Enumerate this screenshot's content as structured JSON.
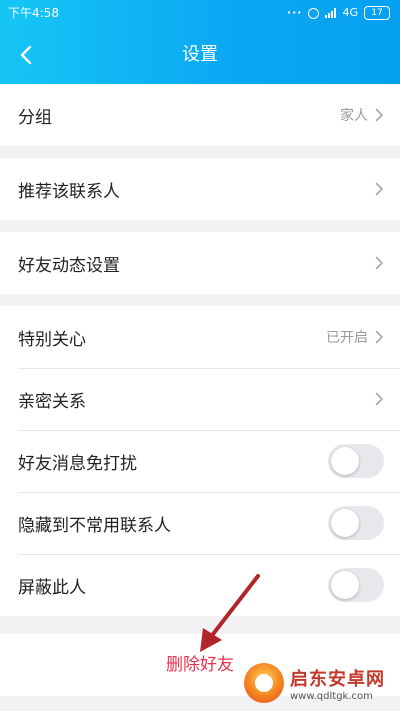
{
  "status_bar": {
    "time": "下午4:58",
    "network": "4G",
    "battery": "17"
  },
  "header": {
    "title": "设置"
  },
  "groups": [
    {
      "rows": [
        {
          "label": "分组",
          "value": "家人"
        }
      ]
    },
    {
      "rows": [
        {
          "label": "推荐该联系人",
          "value": ""
        }
      ]
    },
    {
      "rows": [
        {
          "label": "好友动态设置",
          "value": ""
        }
      ]
    },
    {
      "rows": [
        {
          "label": "特别关心",
          "value": "已开启"
        },
        {
          "label": "亲密关系",
          "value": ""
        },
        {
          "label": "好友消息免打扰",
          "toggle": false
        },
        {
          "label": "隐藏到不常用联系人",
          "toggle": false
        },
        {
          "label": "屏蔽此人",
          "toggle": false
        }
      ]
    }
  ],
  "delete_button": "删除好友",
  "watermark": {
    "title": "启东安卓网",
    "url": "www.qdltgk.com"
  },
  "colors": {
    "header": "#0aa6f3",
    "danger": "#e8334f",
    "annotation_arrow": "#b0262b"
  }
}
